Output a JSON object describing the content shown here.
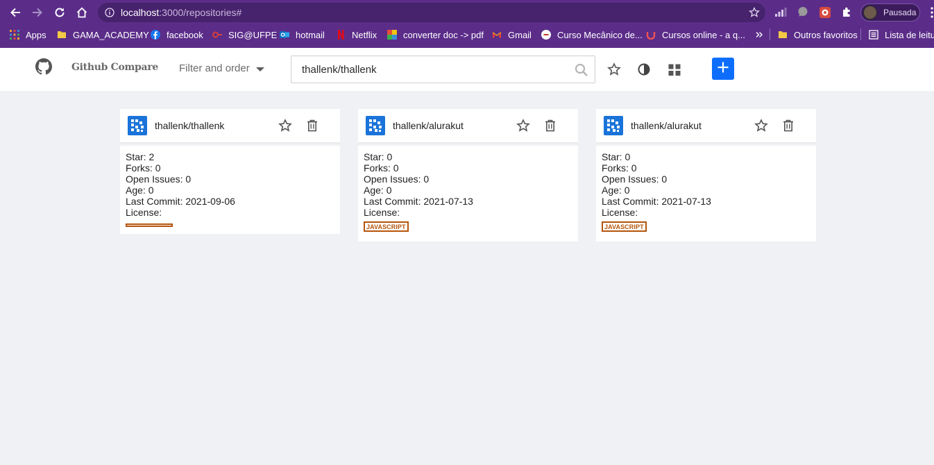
{
  "browser": {
    "url_host": "localhost",
    "url_rest": ":3000/repositories#",
    "profile_label": "Pausada"
  },
  "bookmarks": [
    {
      "label": "Apps",
      "icon": "apps-grid-icon",
      "color": "#e8a23b"
    },
    {
      "label": "GAMA_ACADEMY",
      "icon": "folder-icon",
      "color": "#f4c945"
    },
    {
      "label": "facebook",
      "icon": "facebook-icon",
      "color": "#1877f2"
    },
    {
      "label": "SIG@UFPE",
      "icon": "sig-icon",
      "color": "#d6403a"
    },
    {
      "label": "hotmail",
      "icon": "outlook-icon",
      "color": "#0f6cbd"
    },
    {
      "label": "Netflix",
      "icon": "netflix-icon",
      "color": "#e50914"
    },
    {
      "label": "converter doc -> pdf",
      "icon": "converter-icon",
      "color": "#38b24a"
    },
    {
      "label": "Gmail",
      "icon": "gmail-icon",
      "color": "#ea4335"
    },
    {
      "label": "Curso Mecânico de...",
      "icon": "course-icon",
      "color": "#ffffff"
    },
    {
      "label": "Cursos online - a q...",
      "icon": "udemy-icon",
      "color": "#ec5252"
    },
    {
      "label": "Outros favoritos",
      "icon": "folder-icon",
      "color": "#f4c945"
    },
    {
      "label": "Lista de leitura",
      "icon": "reading-list-icon",
      "color": "#ffffff"
    }
  ],
  "app": {
    "brand": "Github Compare",
    "filter_label": "Filter and order",
    "search_value": "thallenk/thallenk",
    "accent_color": "#0d6efd",
    "language_color": "#b4540c"
  },
  "repositories": [
    {
      "name": "thallenk/thallenk",
      "star": "Star: 2",
      "forks": "Forks: 0",
      "issues": "Open Issues: 0",
      "age": "Age: 0",
      "last_commit": "Last Commit: 2021-09-06",
      "license": "License:",
      "language": ""
    },
    {
      "name": "thallenk/alurakut",
      "star": "Star: 0",
      "forks": "Forks: 0",
      "issues": "Open Issues: 0",
      "age": "Age: 0",
      "last_commit": "Last Commit: 2021-07-13",
      "license": "License:",
      "language": "JAVASCRIPT"
    },
    {
      "name": "thallenk/alurakut",
      "star": "Star: 0",
      "forks": "Forks: 0",
      "issues": "Open Issues: 0",
      "age": "Age: 0",
      "last_commit": "Last Commit: 2021-07-13",
      "license": "License:",
      "language": "JAVASCRIPT"
    }
  ]
}
